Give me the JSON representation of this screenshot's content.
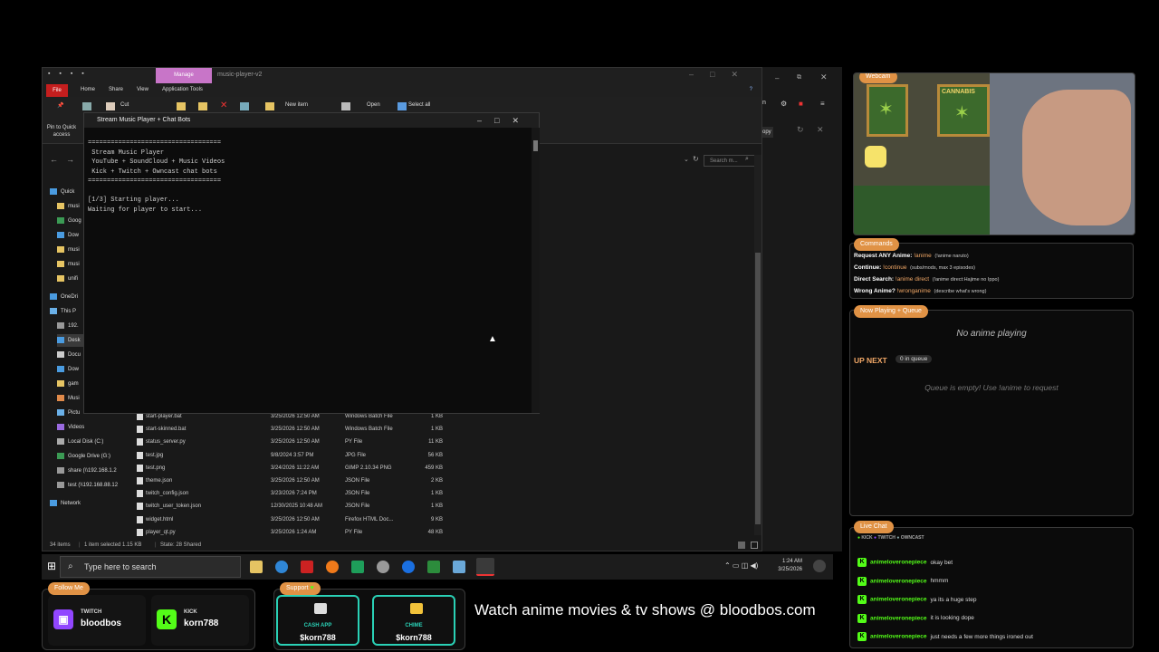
{
  "explorer": {
    "manage_tab": "Manage",
    "title": "music-player-v2",
    "ribbon_tabs": [
      "File",
      "Home",
      "Share",
      "View",
      "Application Tools"
    ],
    "ribbon": {
      "pin_label": "Pin to Quick access",
      "cut_label": "Cut",
      "new_item_label": "New item",
      "open_label": "Open",
      "select_all_label": "Select all"
    },
    "search_placeholder": "Search m...",
    "nav_items": [
      {
        "label": "Quick",
        "icon": "star-icon"
      },
      {
        "label": "musi",
        "icon": "folder-icon"
      },
      {
        "label": "Goog",
        "icon": "drive-icon"
      },
      {
        "label": "Dow",
        "icon": "download-icon"
      },
      {
        "label": "musi",
        "icon": "folder-icon"
      },
      {
        "label": "musi",
        "icon": "folder-icon"
      },
      {
        "label": "unifi",
        "icon": "folder-icon"
      },
      {
        "label": "OneDri",
        "icon": "cloud-icon"
      },
      {
        "label": "This P",
        "icon": "pc-icon"
      },
      {
        "label": "192.",
        "icon": "network-drive-icon"
      },
      {
        "label": "Desk",
        "icon": "desktop-icon"
      },
      {
        "label": "Docu",
        "icon": "documents-icon"
      },
      {
        "label": "Dow",
        "icon": "download-icon"
      },
      {
        "label": "gam",
        "icon": "folder-icon"
      },
      {
        "label": "Musi",
        "icon": "music-icon"
      },
      {
        "label": "Pictu",
        "icon": "pictures-icon"
      },
      {
        "label": "Videos",
        "icon": "videos-icon"
      },
      {
        "label": "Local Disk (C:)",
        "icon": "disk-icon"
      },
      {
        "label": "Google Drive (G:)",
        "icon": "drive-icon"
      },
      {
        "label": "share (\\\\192.168.1.2",
        "icon": "network-drive-icon"
      },
      {
        "label": "test (\\\\192.168.88.12",
        "icon": "network-drive-icon"
      },
      {
        "label": "Network",
        "icon": "network-icon"
      }
    ],
    "files": [
      {
        "name": "start-player.bat",
        "date": "3/25/2026 12:50 AM",
        "type": "Windows Batch File",
        "size": "1 KB"
      },
      {
        "name": "start-skinned.bat",
        "date": "3/25/2026 12:50 AM",
        "type": "Windows Batch File",
        "size": "1 KB"
      },
      {
        "name": "status_server.py",
        "date": "3/25/2026 12:50 AM",
        "type": "PY File",
        "size": "11 KB"
      },
      {
        "name": "test.jpg",
        "date": "9/8/2024 3:57 PM",
        "type": "JPG File",
        "size": "56 KB"
      },
      {
        "name": "test.png",
        "date": "3/24/2026 11:22 AM",
        "type": "GIMP 2.10.34 PNG",
        "size": "459 KB"
      },
      {
        "name": "theme.json",
        "date": "3/25/2026 12:50 AM",
        "type": "JSON File",
        "size": "2 KB"
      },
      {
        "name": "twitch_config.json",
        "date": "3/23/2026 7:24 PM",
        "type": "JSON File",
        "size": "1 KB"
      },
      {
        "name": "twitch_user_token.json",
        "date": "12/30/2025 10:48 AM",
        "type": "JSON File",
        "size": "1 KB"
      },
      {
        "name": "widget.html",
        "date": "3/25/2026 12:50 AM",
        "type": "Firefox HTML Doc...",
        "size": "9 KB"
      },
      {
        "name": "player_qt.py",
        "date": "3/25/2026 1:24 AM",
        "type": "PY File",
        "size": "48 KB"
      }
    ],
    "status": {
      "items": "34 items",
      "selected": "1 item selected 1.15 KB",
      "state": "State: 28 Shared"
    }
  },
  "console": {
    "title": "Stream Music Player + Chat Bots",
    "lines": [
      "===================================",
      " Stream Music Player",
      " YouTube + SoundCloud + Music Videos",
      " Kick + Twitch + Owncast chat bots",
      "===================================",
      "",
      "[1/3] Starting player...",
      "Waiting for player to start..."
    ]
  },
  "browser": {
    "copy_label": "opy"
  },
  "taskbar": {
    "search_placeholder": "Type here to search",
    "time": "1:24 AM",
    "date": "3/25/2026"
  },
  "webcam": {
    "label": "Webcam",
    "poster_text": "CANNABIS"
  },
  "commands": {
    "label": "Commands",
    "lines": [
      {
        "title": "Request ANY Anime:",
        "cmd": "!anime",
        "desc": "(!anime naruto)"
      },
      {
        "title": "Continue:",
        "cmd": "!continue",
        "desc": "(subs/mods, max 3 episodes)"
      },
      {
        "title": "Direct Search:",
        "cmd": "!anime direct",
        "desc": "(!anime direct:Hajime no Ippo)"
      },
      {
        "title": "Wrong Anime?",
        "cmd": "!wronganime",
        "desc": "(describe what's wrong)"
      }
    ]
  },
  "now_playing": {
    "label": "Now Playing + Queue",
    "status": "No anime playing",
    "up_next": "UP NEXT",
    "queue_count": "0 in queue",
    "empty_text": "Queue is empty! Use !anime to request"
  },
  "chat": {
    "label": "Live Chat",
    "platforms": [
      "KICK",
      "TWITCH",
      "OWNCAST"
    ],
    "messages": [
      {
        "user": "animeloveronepiece",
        "text": "okay bet"
      },
      {
        "user": "animeloveronepiece",
        "text": "hmmm"
      },
      {
        "user": "animeloveronepiece",
        "text": "ya its a huge step"
      },
      {
        "user": "animeloveronepiece",
        "text": "it is looking dope"
      },
      {
        "user": "animeloveronepiece",
        "text": "just needs a few more things ironed out"
      }
    ]
  },
  "follow": {
    "label": "Follow Me",
    "twitch_platform": "TWITCH",
    "twitch_name": "bloodbos",
    "kick_platform": "KICK",
    "kick_name": "korn788"
  },
  "support": {
    "label": "Support",
    "cashapp_type": "CASH APP",
    "cashapp_tag": "$korn788",
    "chime_type": "CHIME",
    "chime_tag": "$korn788"
  },
  "promo": "Watch anime movies & tv shows @ bloodbos.com",
  "colors": {
    "accent_orange": "#e09245",
    "kick_green": "#53fc18",
    "twitch_purple": "#9146ff",
    "pay_teal": "#2ad1b6",
    "manage_pink": "#c875c8",
    "file_red": "#c51e1e"
  }
}
